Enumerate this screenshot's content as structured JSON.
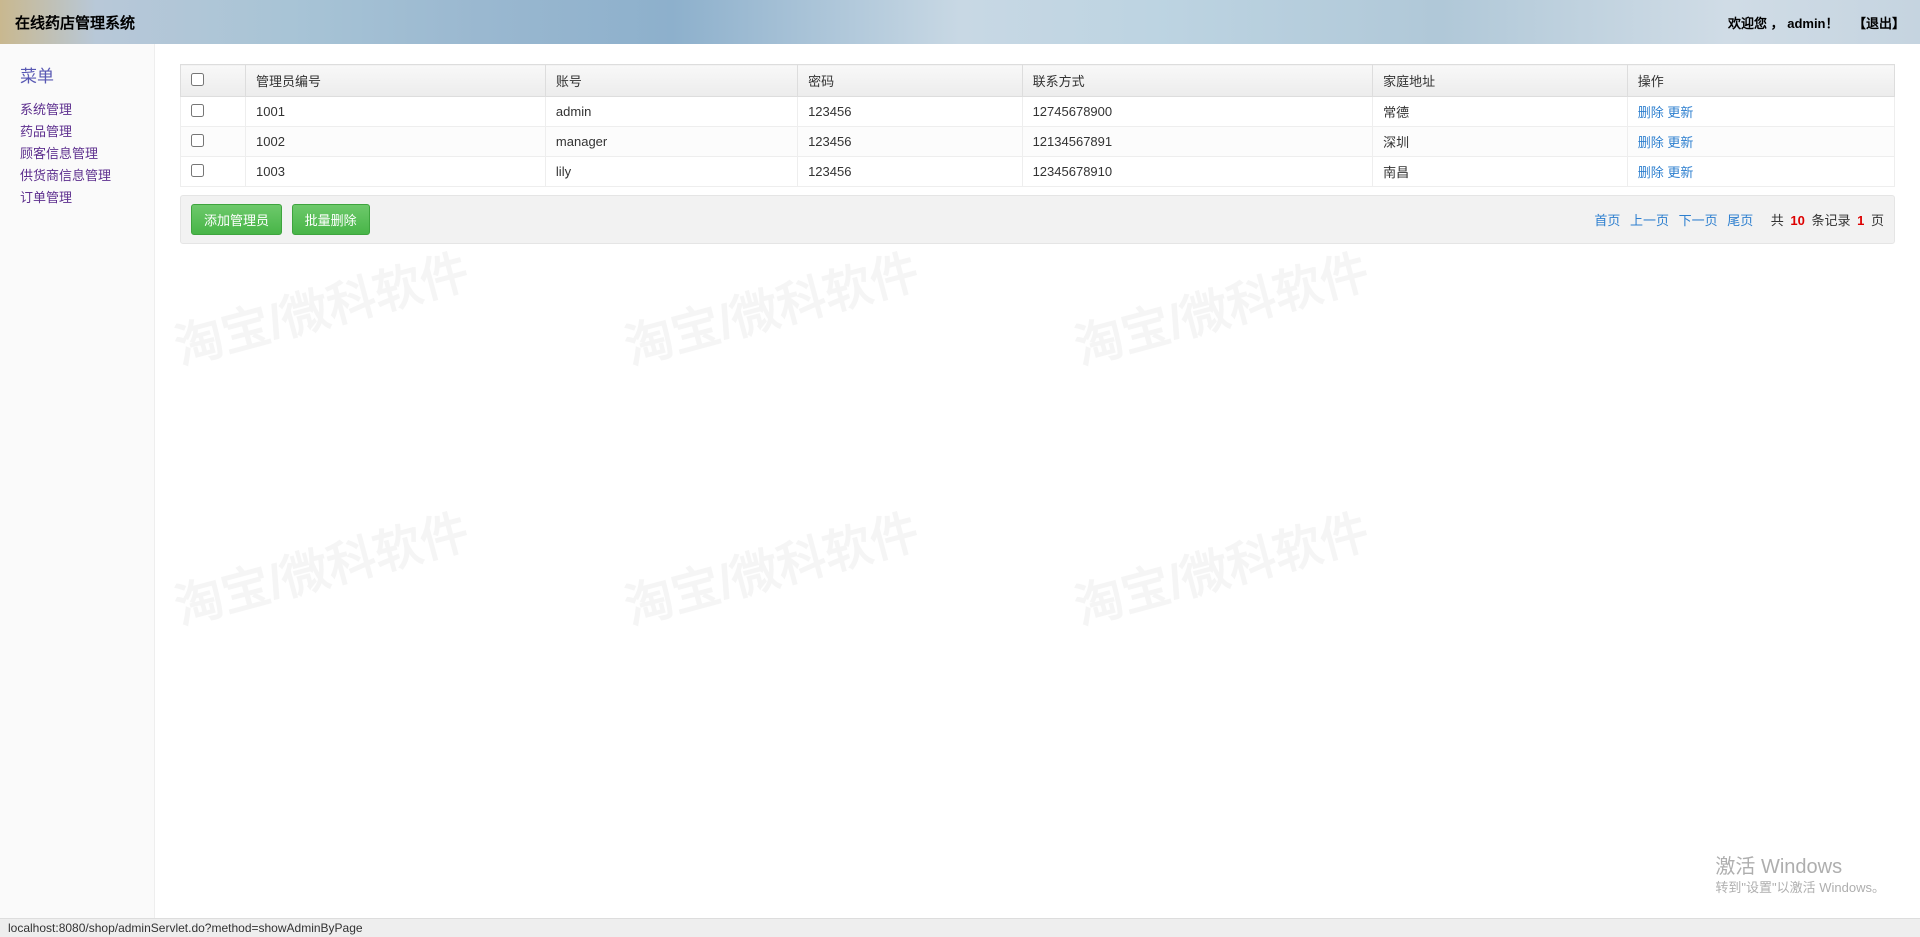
{
  "header": {
    "title": "在线药店管理系统",
    "welcome_prefix": "欢迎您 ，",
    "username": "admin",
    "welcome_suffix": "！",
    "logout_label": "【退出】"
  },
  "sidebar": {
    "title": "菜单",
    "items": [
      {
        "label": "系统管理"
      },
      {
        "label": "药品管理"
      },
      {
        "label": "顾客信息管理"
      },
      {
        "label": "供货商信息管理"
      },
      {
        "label": "订单管理"
      }
    ]
  },
  "table": {
    "columns": [
      "管理员编号",
      "账号",
      "密码",
      "联系方式",
      "家庭地址",
      "操作"
    ],
    "rows": [
      {
        "id": "1001",
        "account": "admin",
        "password": "123456",
        "contact": "12745678900",
        "address": "常德"
      },
      {
        "id": "1002",
        "account": "manager",
        "password": "123456",
        "contact": "12134567891",
        "address": "深圳"
      },
      {
        "id": "1003",
        "account": "lily",
        "password": "123456",
        "contact": "12345678910",
        "address": "南昌"
      }
    ],
    "op_delete": "删除",
    "op_update": "更新"
  },
  "footer": {
    "add_button": "添加管理员",
    "batch_delete": "批量删除",
    "pager": {
      "first": "首页",
      "prev": "上一页",
      "next": "下一页",
      "last": "尾页",
      "total_prefix": "共",
      "total_count": "10",
      "total_mid": "条记录",
      "total_pages": "1",
      "total_suffix": "页"
    }
  },
  "statusbar": {
    "url": "localhost:8080/shop/adminServlet.do?method=showAdminByPage"
  },
  "activation": {
    "line1": "激活 Windows",
    "line2": "转到\"设置\"以激活 Windows。"
  },
  "watermark_text": "淘宝/微科软件"
}
